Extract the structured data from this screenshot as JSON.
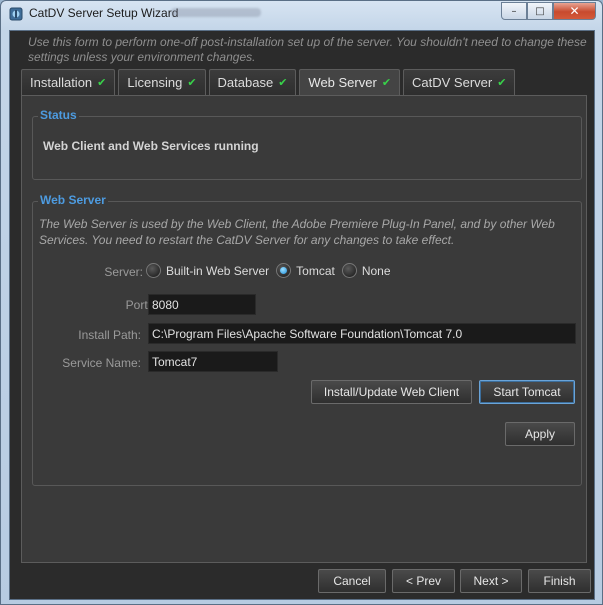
{
  "window": {
    "title": "CatDV Server Setup Wizard",
    "caption_buttons": {
      "minimize": "–",
      "maximize": "□",
      "close": "✕"
    }
  },
  "intro_text": "Use this form to perform one-off post-installation set up of the server. You shouldn't need to change these settings unless your environment changes.",
  "tabs": [
    {
      "label": "Installation",
      "checked": true
    },
    {
      "label": "Licensing",
      "checked": true
    },
    {
      "label": "Database",
      "checked": true
    },
    {
      "label": "Web Server",
      "checked": true,
      "active": true
    },
    {
      "label": "CatDV Server",
      "checked": true
    }
  ],
  "check_glyph": "✔",
  "status": {
    "title": "Status",
    "message": "Web Client and Web Services running"
  },
  "web_server": {
    "title": "Web Server",
    "description": "The Web Server is used by the Web Client, the Adobe Premiere Plug-In Panel, and by other Web Services. You need to restart the CatDV Server for any changes to take effect.",
    "server_label": "Server:",
    "server_options": [
      "Built-in Web Server",
      "Tomcat",
      "None"
    ],
    "server_selected": "Tomcat",
    "port_label": "Port:",
    "port_value": "8080",
    "install_path_label": "Install Path:",
    "install_path_value": "C:\\Program Files\\Apache Software Foundation\\Tomcat 7.0",
    "service_name_label": "Service Name:",
    "service_name_value": "Tomcat7",
    "install_update_button": "Install/Update Web Client",
    "start_button": "Start Tomcat",
    "apply_button": "Apply"
  },
  "footer": {
    "cancel": "Cancel",
    "prev": "< Prev",
    "next": "Next >",
    "finish": "Finish"
  },
  "colors": {
    "accent_title": "#4d9be0",
    "check": "#38d34a",
    "panel_bg": "#3a3a3a",
    "field_bg": "#1a1a1a"
  }
}
